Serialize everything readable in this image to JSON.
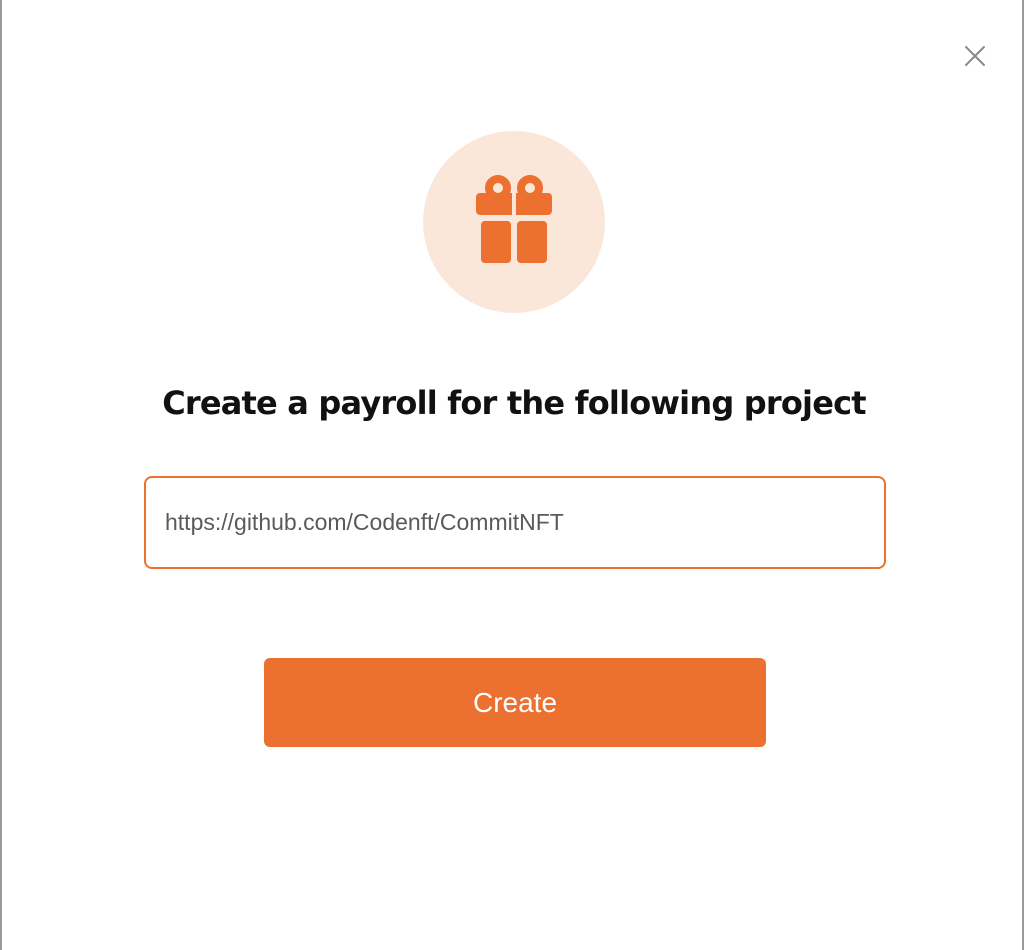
{
  "colors": {
    "accent": "#ec7030",
    "icon_bg": "#fbe7da",
    "close_icon": "#8a8a8a"
  },
  "dialog": {
    "close_icon": "close-icon",
    "hero_icon": "gift-icon",
    "title": "Create a payroll for the following project",
    "url_input": {
      "value": "https://github.com/Codenft/CommitNFT",
      "placeholder": ""
    },
    "create_label": "Create"
  }
}
